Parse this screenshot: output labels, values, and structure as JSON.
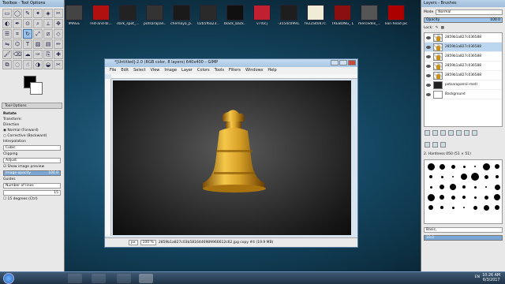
{
  "desktop": {
    "icons": [
      {
        "label": "IMAGE",
        "color": "#444"
      },
      {
        "label": "red-and-bl...",
        "color": "#b01010"
      },
      {
        "label": "dark_spot_...",
        "color": "#222"
      },
      {
        "label": "potsarapan...",
        "color": "#333"
      },
      {
        "label": "chemaya_p...",
        "color": "#1a1a1a"
      },
      {
        "label": "02b5f6a23...",
        "color": "#2a2a2a"
      },
      {
        "label": "black_back...",
        "color": "#101010"
      },
      {
        "label": "v7lUcj",
        "color": "#c02030"
      },
      {
        "label": "-3554c0991...",
        "color": "#1e1e1e"
      },
      {
        "label": "fe22a4047c...",
        "color": "#f0ecd8"
      },
      {
        "label": "TREBONG_ DESIGN2",
        "color": "#8a1010"
      },
      {
        "label": "mercedes_...",
        "color": "#555"
      },
      {
        "label": "lion head pictures 3",
        "color": "#a00"
      }
    ]
  },
  "toolbox": {
    "title": "Toolbox - Tool Options",
    "tool_icons": [
      "rect-select",
      "ellipse-select",
      "free-select",
      "fuzzy-select",
      "color-select",
      "scissors",
      "foreground-select",
      "paths",
      "color-picker",
      "zoom",
      "measure",
      "move",
      "align",
      "crop",
      "rotate",
      "scale",
      "shear",
      "perspective",
      "flip",
      "cage",
      "text",
      "bucket-fill",
      "blend",
      "pencil",
      "paintbrush",
      "eraser",
      "airbrush",
      "ink",
      "clone",
      "heal",
      "perspective-clone",
      "blur",
      "smudge",
      "dodge",
      "dodge-burn",
      "scissors-2"
    ],
    "tab_label": "Tool Options",
    "tool_name": "Rotate",
    "transform_label": "Transform:",
    "direction_label": "Direction",
    "direction_normal": "Normal (Forward)",
    "direction_corrective": "Corrective (Backward)",
    "interpolation_label": "Interpolation",
    "interpolation_value": "Cubic",
    "clipping_label": "Clipping",
    "clipping_value": "Adjust",
    "show_preview_label": "Show image preview",
    "image_opacity_label": "Image opacity",
    "image_opacity_value": "100.0",
    "guides_label": "Guides",
    "guides_value": "Number of lines",
    "lines_value": "15",
    "degrees_label": "15 degrees (Ctrl)"
  },
  "image_window": {
    "title": "*[Untitled]-2.0 (RGB color, 8 layers) 640x400 – GIMP",
    "menu": [
      "File",
      "Edit",
      "Select",
      "View",
      "Image",
      "Layer",
      "Colors",
      "Tools",
      "Filters",
      "Windows",
      "Help"
    ],
    "unit": "px",
    "zoom": "100 %",
    "status": "2859b1a827c03b5816446989966612c62.jpg copy #4 (19.9 MB)"
  },
  "layers_panel": {
    "title": "Layers - Brushes",
    "mode_label": "Mode",
    "mode_value": "Normal",
    "opacity_label": "Opacity",
    "opacity_value": "100.0",
    "lock_label": "Lock:",
    "layers": [
      {
        "name": "2859b1a827c036588",
        "thumb": "bell",
        "selected": false
      },
      {
        "name": "2859b1a827c036588",
        "thumb": "bell",
        "selected": true
      },
      {
        "name": "2859b1a827c036588",
        "thumb": "bell",
        "selected": false
      },
      {
        "name": "2859b1a827c036588",
        "thumb": "bell",
        "selected": false
      },
      {
        "name": "2859b1a827c036588",
        "thumb": "bell",
        "selected": false
      },
      {
        "name": "potsarapannii-metl",
        "thumb": "dark",
        "selected": false
      },
      {
        "name": "Background",
        "thumb": "text",
        "selected": false
      }
    ],
    "brush_hardness": "2. Hardness 050 (51 × 51)",
    "brush_footer": "Basic,",
    "spacing_value": "10.0"
  },
  "taskbar": {
    "apps": [
      "explorer",
      "media-player",
      "vlc",
      "gimp"
    ],
    "lang": "EN",
    "time": "10:26 AM",
    "date": "6/3/2017"
  }
}
